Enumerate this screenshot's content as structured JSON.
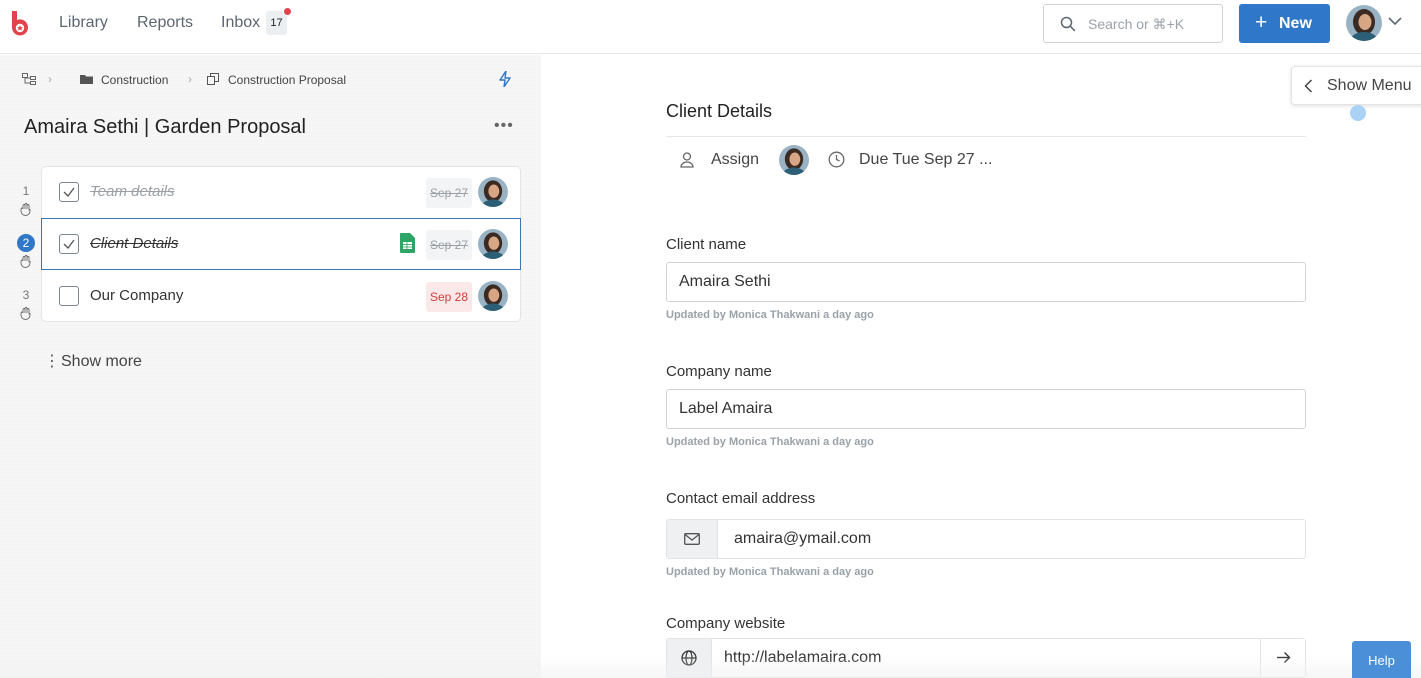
{
  "colors": {
    "brand": "#e0434b",
    "primary": "#2f77c8",
    "accent_progress": "#5fb89b",
    "overdue": "#d23c3c"
  },
  "topbar": {
    "nav": [
      "Library",
      "Reports",
      "Inbox"
    ],
    "inbox_count": "17",
    "search_placeholder": "Search or ⌘+K",
    "new_label": "New"
  },
  "breadcrumb": {
    "items": [
      "Construction",
      "Construction Proposal"
    ]
  },
  "project": {
    "title": "Amaira Sethi | Garden Proposal"
  },
  "tasks": [
    {
      "num": "1",
      "name": "Team details",
      "due": "Sep 27",
      "completed": true,
      "status": "past"
    },
    {
      "num": "2",
      "name": "Client Details",
      "due": "Sep 27",
      "completed": true,
      "status": "past",
      "selected": true,
      "has_sheet": true
    },
    {
      "num": "3",
      "name": "Our Company",
      "due": "Sep 28",
      "completed": false,
      "status": "overdue"
    }
  ],
  "show_more_label": "Show more",
  "detail": {
    "section_title": "Client Details",
    "assign_label": "Assign",
    "due_label": "Due Tue Sep 27 ..."
  },
  "fields": [
    {
      "label": "Client name",
      "value": "Amaira Sethi",
      "note": "Updated by Monica Thakwani a day ago"
    },
    {
      "label": "Company name",
      "value": "Label Amaira",
      "note": "Updated by Monica Thakwani a day ago"
    },
    {
      "label": "Contact email address",
      "value": "amaira@ymail.com",
      "note": "Updated by Monica Thakwani a day ago"
    },
    {
      "label": "Company website",
      "value": "http://labelamaira.com"
    }
  ],
  "show_menu_label": "Show Menu",
  "help_label": "Help",
  "icons": {
    "logo": "brand-logo-icon",
    "search": "search-icon",
    "workflow": "workflow-icon",
    "folder": "folder-icon",
    "copy": "copy-icon",
    "bolt": "lightning-icon",
    "person": "person-icon",
    "clock": "clock-icon",
    "mail": "mail-icon",
    "globe": "globe-icon",
    "arrow": "arrow-right-icon"
  }
}
